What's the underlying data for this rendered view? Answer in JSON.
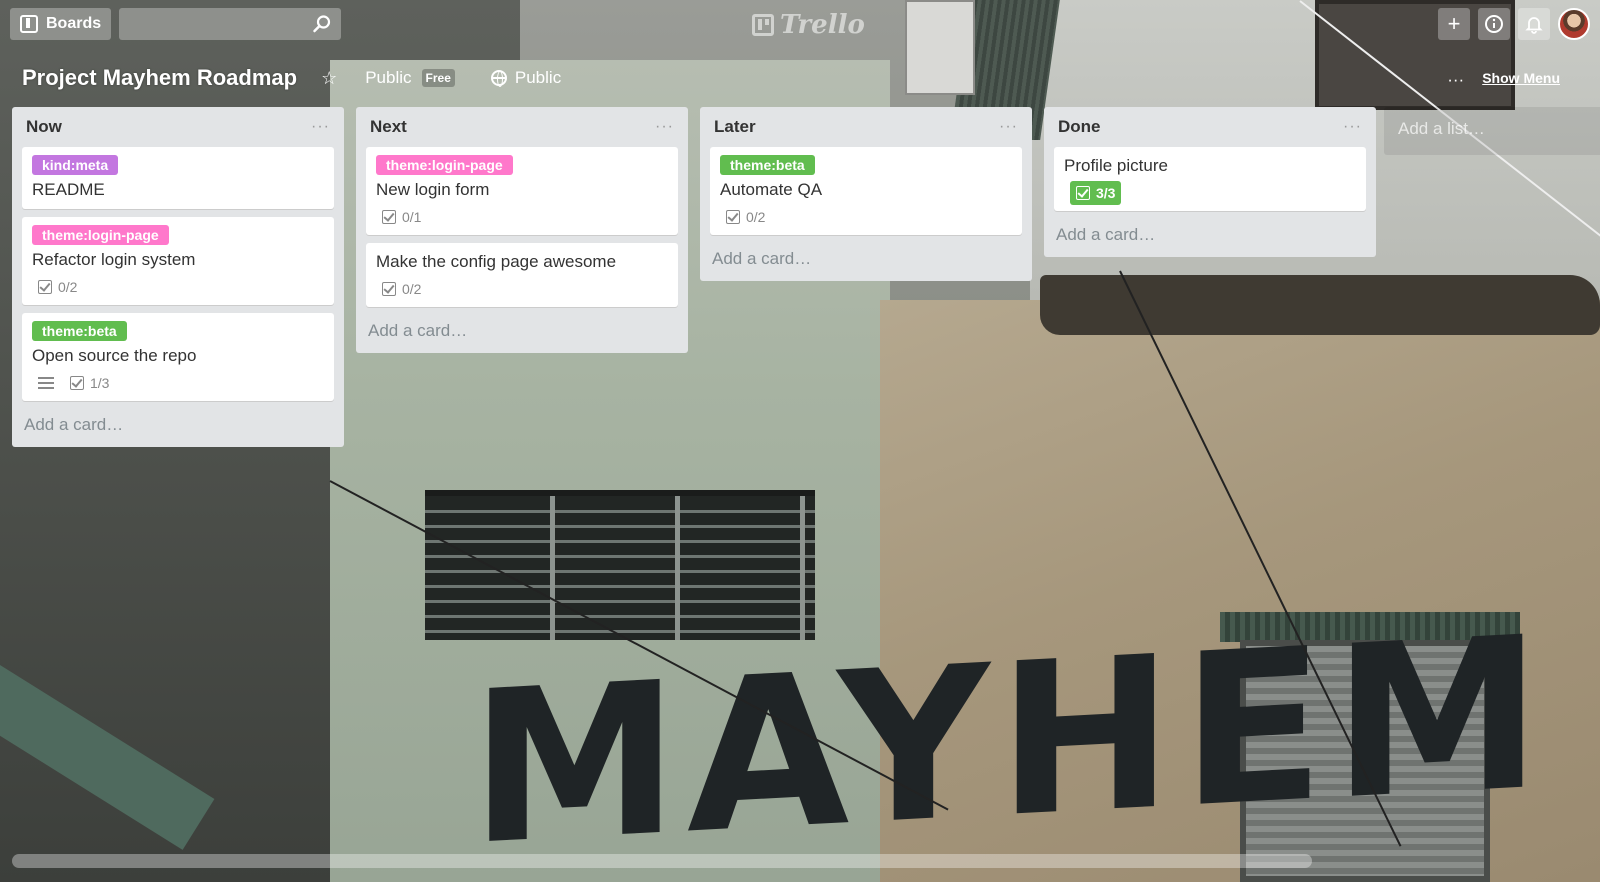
{
  "header": {
    "boards_label": "Boards",
    "search_value": "",
    "logo_text": "Trello",
    "icons": [
      "boards-icon",
      "search-icon",
      "plus-icon",
      "info-icon",
      "bell-icon",
      "avatar"
    ]
  },
  "board": {
    "title": "Project Mayhem Roadmap",
    "team": "Public",
    "team_badge": "Free",
    "visibility": "Public",
    "show_menu": "Show Menu",
    "menu_dots": "···"
  },
  "lists": [
    {
      "title": "Now",
      "menu": "···",
      "add_card": "Add a card…",
      "cards": [
        {
          "label": "kind:meta",
          "label_color": "#c377e0",
          "title": "README",
          "badges": []
        },
        {
          "label": "theme:login-page",
          "label_color": "#ff78cb",
          "title": "Refactor login system",
          "badges": [
            {
              "type": "checklist",
              "text": "0/2"
            }
          ]
        },
        {
          "label": "theme:beta",
          "label_color": "#61bd4f",
          "title": "Open source the repo",
          "badges": [
            {
              "type": "description",
              "text": ""
            },
            {
              "type": "checklist",
              "text": "1/3"
            }
          ]
        }
      ]
    },
    {
      "title": "Next",
      "menu": "···",
      "add_card": "Add a card…",
      "cards": [
        {
          "label": "theme:login-page",
          "label_color": "#ff78cb",
          "title": "New login form",
          "badges": [
            {
              "type": "checklist",
              "text": "0/1"
            }
          ]
        },
        {
          "label": "",
          "label_color": "",
          "title": "Make the config page awesome",
          "badges": [
            {
              "type": "checklist",
              "text": "0/2"
            }
          ]
        }
      ]
    },
    {
      "title": "Later",
      "menu": "···",
      "add_card": "Add a card…",
      "cards": [
        {
          "label": "theme:beta",
          "label_color": "#61bd4f",
          "title": "Automate QA",
          "badges": [
            {
              "type": "checklist",
              "text": "0/2"
            }
          ]
        }
      ]
    },
    {
      "title": "Done",
      "menu": "···",
      "add_card": "Add a card…",
      "cards": [
        {
          "label": "",
          "label_color": "",
          "title": "Profile picture",
          "badges": [
            {
              "type": "checklist-complete",
              "text": "3/3"
            }
          ]
        }
      ]
    }
  ],
  "add_list": "Add a list…",
  "background_text": "MAYHEM",
  "colors": {
    "list_bg": "#e2e4e6",
    "label_purple": "#c377e0",
    "label_pink": "#ff78cb",
    "label_green": "#61bd4f"
  }
}
